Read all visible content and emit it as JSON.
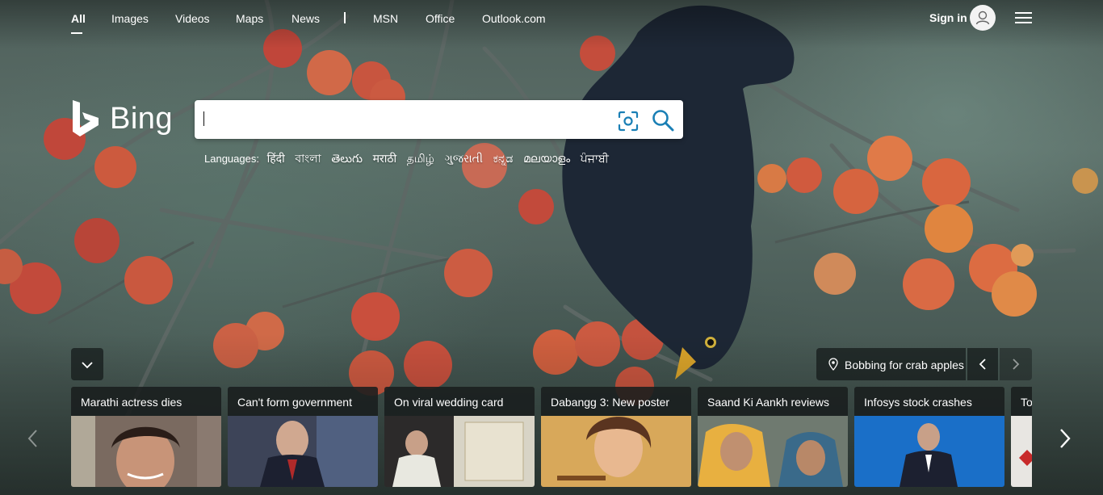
{
  "topnav": {
    "links": [
      {
        "label": "All",
        "active": true
      },
      {
        "label": "Images"
      },
      {
        "label": "Videos"
      },
      {
        "label": "Maps"
      },
      {
        "label": "News"
      },
      {
        "label": "MSN"
      },
      {
        "label": "Office"
      },
      {
        "label": "Outlook.com"
      }
    ],
    "signin_label": "Sign in",
    "avatar_icon": "person-icon",
    "menu_icon": "hamburger-icon"
  },
  "logo": {
    "text": "Bing",
    "icon": "bing-logo-icon"
  },
  "search": {
    "value": "",
    "visual_search_icon": "visual-search-icon",
    "search_icon": "magnifier-icon"
  },
  "languages": {
    "label": "Languages:",
    "items": [
      "हिंदी",
      "বাংলা",
      "తెలుగు",
      "मराठी",
      "தமிழ்",
      "ગુજરાતી",
      "ಕನ್ನಡ",
      "മലയാളം",
      "ਪੰਜਾਬੀ"
    ]
  },
  "image_info": {
    "caption": "Bobbing for crab apples",
    "pin_icon": "location-pin-icon",
    "prev_icon": "chevron-left-icon",
    "next_icon": "chevron-right-icon"
  },
  "collapse_icon": "chevron-down-icon",
  "news": {
    "cards": [
      {
        "title": "Marathi actress dies"
      },
      {
        "title": "Can't form government"
      },
      {
        "title": "On viral wedding card"
      },
      {
        "title": "Dabangg 3: New poster"
      },
      {
        "title": "Saand Ki Aankh reviews"
      },
      {
        "title": "Infosys stock crashes"
      },
      {
        "title": "To"
      }
    ],
    "prev_icon": "chevron-left-icon",
    "next_icon": "chevron-right-icon"
  },
  "colors": {
    "accent": "#1a7fb5",
    "overlay": "#191e1e"
  }
}
